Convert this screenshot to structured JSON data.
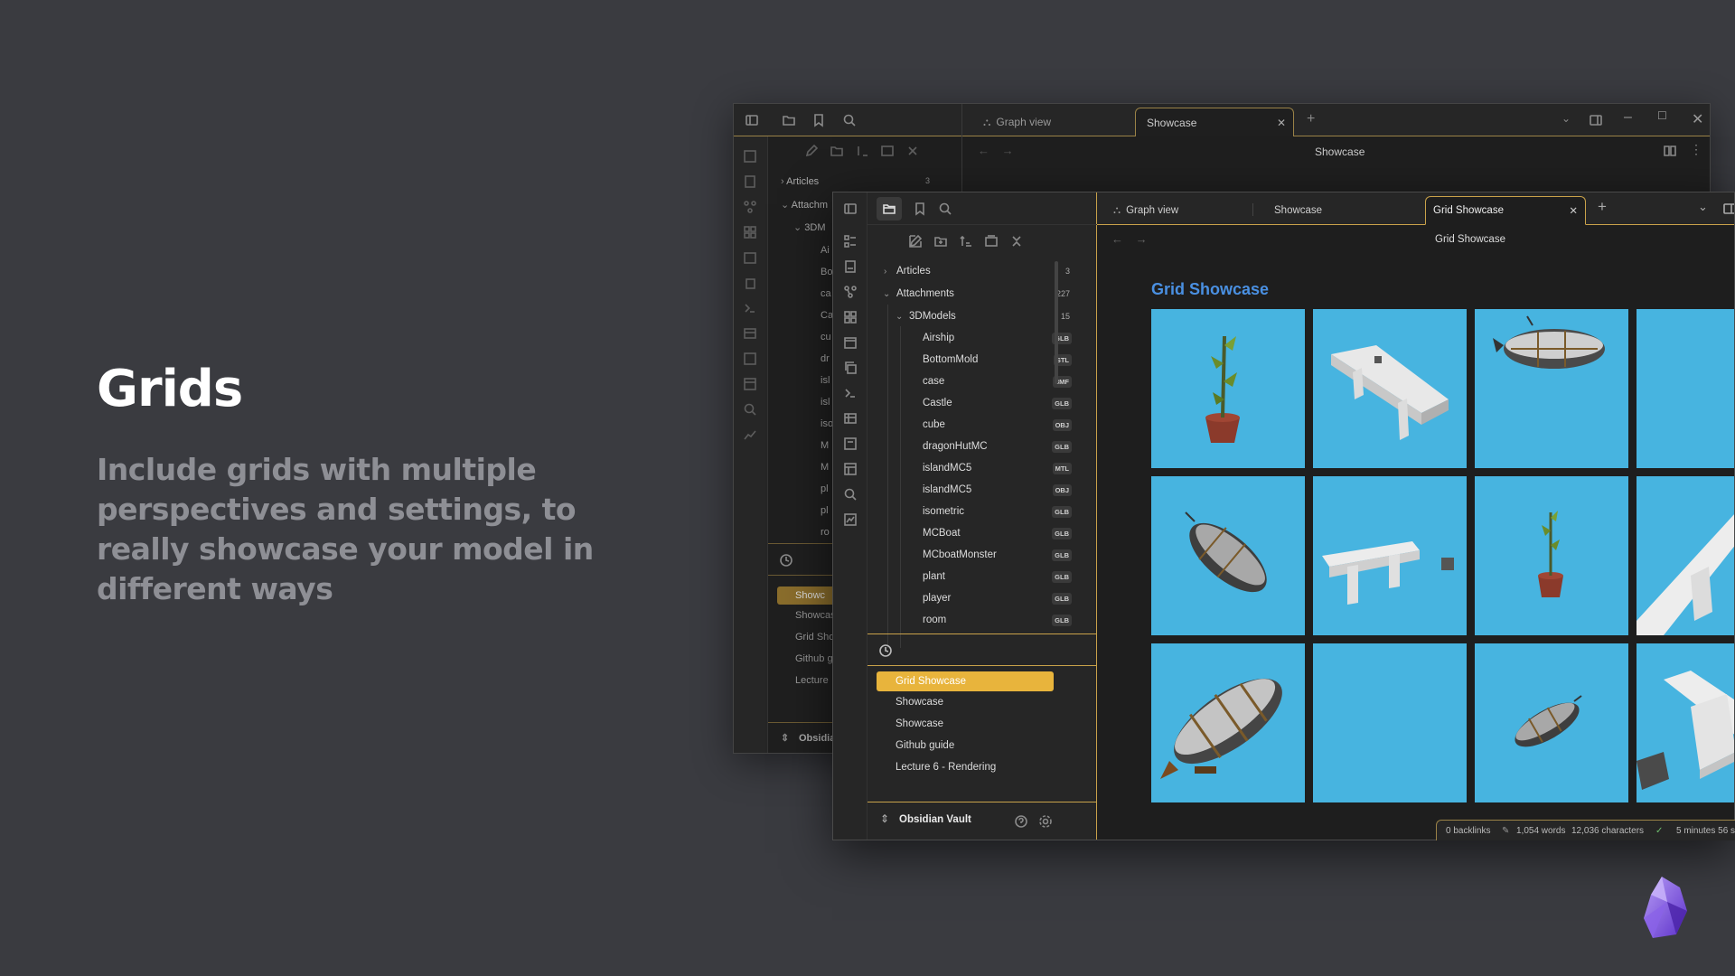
{
  "hero": {
    "title": "Grids",
    "subtitle": "Include grids with multiple perspectives and settings, to really showcase your model in different ways"
  },
  "back_window": {
    "tabs": [
      {
        "label": "Graph view",
        "icon": "graph-icon"
      },
      {
        "label": "Showcase",
        "active": true
      }
    ],
    "header_title": "Showcase",
    "tree": [
      {
        "label": "Articles",
        "count": "3"
      },
      {
        "label": "Attachm"
      },
      {
        "label": "3DM"
      },
      {
        "label": "Ai"
      },
      {
        "label": "Bo"
      },
      {
        "label": "ca"
      },
      {
        "label": "Ca"
      },
      {
        "label": "cu"
      },
      {
        "label": "dr"
      },
      {
        "label": "isl"
      },
      {
        "label": "isl"
      },
      {
        "label": "iso"
      },
      {
        "label": "M"
      },
      {
        "label": "M"
      },
      {
        "label": "pl"
      },
      {
        "label": "pl"
      },
      {
        "label": "ro"
      }
    ],
    "recent": [
      {
        "label": "Showc",
        "selected": true
      },
      {
        "label": "Showcas"
      },
      {
        "label": "Grid Sho"
      },
      {
        "label": "Github g"
      },
      {
        "label": "Lecture"
      }
    ],
    "vault": "Obsidia"
  },
  "front_window": {
    "tabs": [
      {
        "label": "Graph view",
        "icon": "graph-icon"
      },
      {
        "label": "Showcase"
      },
      {
        "label": "Grid Showcase",
        "active": true
      }
    ],
    "header_title": "Grid Showcase",
    "doc_title": "Grid Showcase",
    "tree": {
      "articles": {
        "label": "Articles",
        "count": "3"
      },
      "attachments": {
        "label": "Attachments",
        "count": "227"
      },
      "models": {
        "label": "3DModels",
        "count": "15"
      },
      "files": [
        {
          "label": "Airship",
          "ext": "GLB"
        },
        {
          "label": "BottomMold",
          "ext": "STL"
        },
        {
          "label": "case",
          "ext": "3MF"
        },
        {
          "label": "Castle",
          "ext": "GLB"
        },
        {
          "label": "cube",
          "ext": "OBJ"
        },
        {
          "label": "dragonHutMC",
          "ext": "GLB"
        },
        {
          "label": "islandMC5",
          "ext": "MTL"
        },
        {
          "label": "islandMC5",
          "ext": "OBJ"
        },
        {
          "label": "isometric",
          "ext": "GLB"
        },
        {
          "label": "MCBoat",
          "ext": "GLB"
        },
        {
          "label": "MCboatMonster",
          "ext": "GLB"
        },
        {
          "label": "plant",
          "ext": "GLB"
        },
        {
          "label": "player",
          "ext": "GLB"
        },
        {
          "label": "room",
          "ext": "GLB"
        }
      ]
    },
    "recent": [
      {
        "label": "Grid Showcase",
        "selected": true
      },
      {
        "label": "Showcase"
      },
      {
        "label": "Showcase"
      },
      {
        "label": "Github guide"
      },
      {
        "label": "Lecture 6 - Rendering"
      }
    ],
    "vault": "Obsidian Vault",
    "status": {
      "backlinks": "0 backlinks",
      "words": "1,054 words",
      "chars": "12,036 characters",
      "time": "5 minutes 56 s"
    }
  },
  "grid_cells": [
    {
      "model": "plant"
    },
    {
      "model": "bench"
    },
    {
      "model": "airship"
    },
    {
      "model": "empty"
    },
    {
      "model": "airship"
    },
    {
      "model": "bench"
    },
    {
      "model": "plant"
    },
    {
      "model": "bench"
    },
    {
      "model": "airship"
    },
    {
      "model": "empty"
    },
    {
      "model": "airship"
    },
    {
      "model": "bench"
    }
  ],
  "colors": {
    "accent": "#c9a24a",
    "selected": "#e8b43c",
    "cell_bg": "#47b4e0",
    "title_blue": "#4a90e2",
    "background": "#3a3b40"
  }
}
